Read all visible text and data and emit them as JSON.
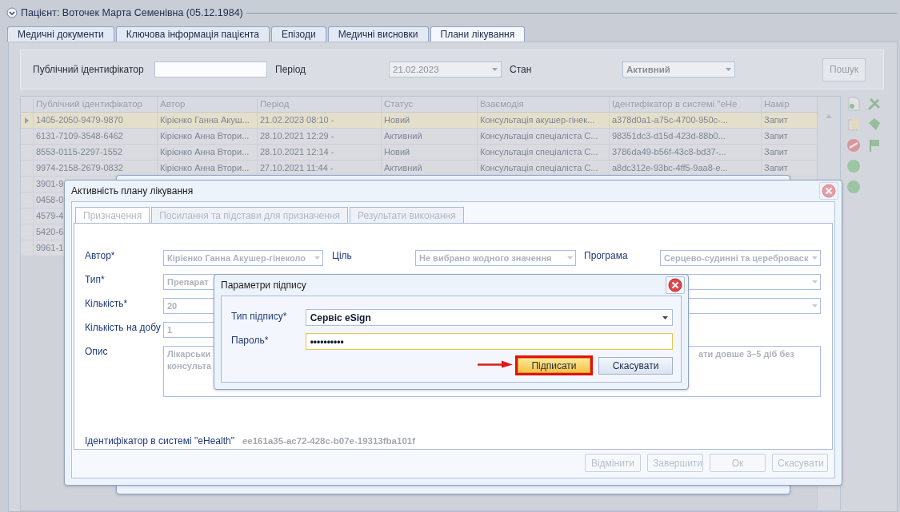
{
  "header": {
    "title": "Пацієнт: Воточек Марта Семенівна (05.12.1984)"
  },
  "tabs": [
    {
      "label": "Медичні документи",
      "selected": false
    },
    {
      "label": "Ключова інформація пацієнта",
      "selected": false
    },
    {
      "label": "Епізоди",
      "selected": false
    },
    {
      "label": "Медичні висновки",
      "selected": false
    },
    {
      "label": "Плани лікування",
      "selected": true
    }
  ],
  "filter": {
    "id_label": "Публічний ідентифікатор",
    "period_label": "Період",
    "period_value": "21.02.2023",
    "state_label": "Стан",
    "state_value": "Активний",
    "search_button": {
      "label": "Пошук",
      "disabled": true
    }
  },
  "table": {
    "columns": [
      "Публічний ідентифікатор",
      "Автор",
      "Період",
      "Статус",
      "Взаємодія",
      "Ідентифікатор в системі \"eHe",
      "Намір"
    ],
    "rows": [
      {
        "selected": true,
        "cells": [
          "1405-2050-9479-9870",
          "Кірієнко Ганна Акуш...",
          "21.02.2023 08:10 -",
          "Новий",
          "Консультація акушер-гінек...",
          "a378d0a1-a75c-4700-950c-...",
          "Запит"
        ]
      },
      {
        "selected": false,
        "cells": [
          "6131-7109-3548-6462",
          "Кірієнко Анна Втори...",
          "28.10.2021 12:29 -",
          "Активний",
          "Консультація спеціаліста С...",
          "98351dc3-d15d-423d-88b0...",
          "Запит"
        ]
      },
      {
        "selected": false,
        "cells": [
          "8553-0115-2297-1552",
          "Кірієнко Анна Втори...",
          "28.10.2021 12:14 -",
          "Новий",
          "Консультація спеціаліста С...",
          "3786da49-b56f-43c8-bd37-...",
          "Запит"
        ]
      },
      {
        "selected": false,
        "cells": [
          "9974-2158-2679-0832",
          "Кірієнко Анна Втори...",
          "27.10.2021 11:44 -",
          "Активний",
          "Консультація спеціаліста С...",
          "a8dc312e-93bc-4ff5-9aa8-e...",
          "Запит"
        ]
      },
      {
        "selected": false,
        "cells": [
          "3901-9"
        ]
      },
      {
        "selected": false,
        "cells": [
          "0458-0"
        ]
      },
      {
        "selected": false,
        "cells": [
          "4579-4"
        ]
      },
      {
        "selected": false,
        "cells": [
          "5420-6"
        ]
      },
      {
        "selected": false,
        "cells": [
          "9961-1"
        ]
      }
    ]
  },
  "dialog": {
    "title": "Активність плану лікування",
    "tabs": [
      {
        "label": "Призначення",
        "selected": true
      },
      {
        "label": "Посилання та підстави для призначення",
        "selected": false
      },
      {
        "label": "Результати виконання",
        "selected": false
      }
    ],
    "form": [
      {
        "label": "Автор*",
        "field": {
          "kind": "select",
          "value": "Кірієнко Ганна Акушер-гінеколо"
        },
        "extras": [
          {
            "label": "Ціль",
            "field": {
              "kind": "select",
              "value": "Не вибрано жодного значення"
            }
          },
          {
            "label": "Програма",
            "field": {
              "kind": "select",
              "value": "Серцево-судинні та цереброваск"
            }
          }
        ]
      },
      {
        "label": "Тип*",
        "field": {
          "kind": "input",
          "value": "Препарат"
        },
        "extras": [
          {
            "field": {
              "kind": "select"
            }
          }
        ]
      },
      {
        "label": "Кількість*",
        "field": {
          "kind": "input",
          "value": "20"
        },
        "extras": [
          {
            "field": {
              "kind": "select"
            }
          }
        ]
      },
      {
        "label": "Кількість на добу",
        "field": {
          "kind": "input",
          "value": "1"
        }
      },
      {
        "label": "Опис",
        "field": {
          "kind": "textarea",
          "left_lines": [
            "Лікарськи",
            "консульта"
          ],
          "right_lines": [
            "ати довше 3–5 діб без"
          ]
        }
      }
    ],
    "ehealth": {
      "label": "Ідентифікатор в системі \"eHealth\"",
      "value": "ee161a35-ac72-428c-b07e-19313fba101f"
    },
    "buttons": [
      {
        "label": "Відмінити",
        "disabled": true
      },
      {
        "label": "Завершити",
        "disabled": true
      },
      {
        "label": "Ок",
        "disabled": true
      },
      {
        "label": "Скасувати",
        "disabled": true
      }
    ]
  },
  "sign_dialog": {
    "title": "Параметри підпису",
    "fields": [
      {
        "label": "Тип підпису*",
        "kind": "select",
        "value": "Сервіс eSign",
        "focused": false
      },
      {
        "label": "Пароль*",
        "kind": "password",
        "value": "••••••••••",
        "focused": true
      }
    ],
    "buttons": [
      {
        "label": "Підписати",
        "highlighted": true
      },
      {
        "label": "Скасувати",
        "highlighted": false
      }
    ]
  }
}
